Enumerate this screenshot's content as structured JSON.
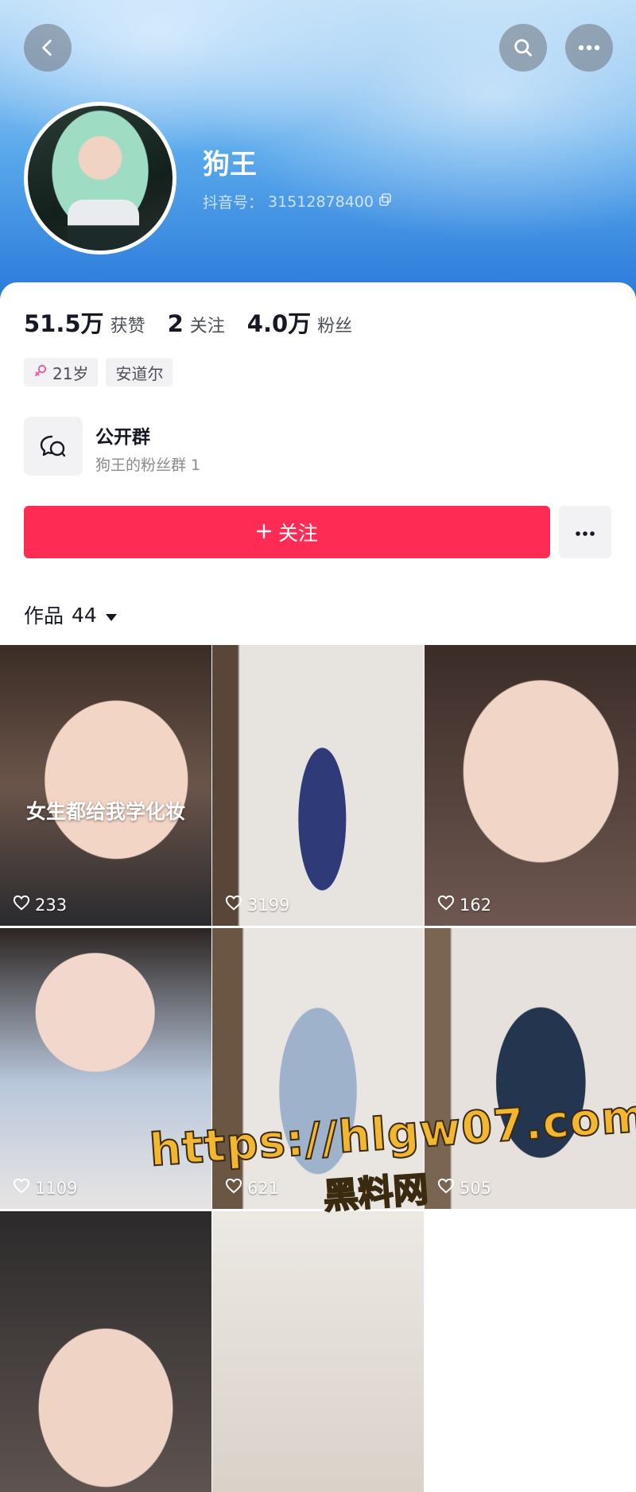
{
  "header": {
    "back_icon": "chevron-left-icon",
    "search_icon": "search-icon",
    "more_icon": "more-horizontal-icon",
    "accent_color": "#1f6fd6"
  },
  "profile": {
    "nickname": "狗王",
    "uid_label": "抖音号：",
    "uid_value": "31512878400"
  },
  "stats": [
    {
      "value": "51.5万",
      "label": "获赞"
    },
    {
      "value": "2",
      "label": "关注"
    },
    {
      "value": "4.0万",
      "label": "粉丝"
    }
  ],
  "tags": {
    "age": "21岁",
    "location": "安道尔"
  },
  "group": {
    "title": "公开群",
    "subtitle": "狗王的粉丝群 1"
  },
  "actions": {
    "follow_label": "关注",
    "follow_color": "#fe2c55"
  },
  "works": {
    "label": "作品",
    "count": "44"
  },
  "videos": [
    {
      "caption": "女生都给我学化妆",
      "likes": "233"
    },
    {
      "caption": "",
      "likes": "3199"
    },
    {
      "caption": "",
      "likes": "162"
    },
    {
      "caption": "",
      "likes": "1109"
    },
    {
      "caption": "",
      "likes": "621"
    },
    {
      "caption": "",
      "likes": "505"
    },
    {
      "caption": "",
      "likes": ""
    },
    {
      "caption": "",
      "likes": ""
    },
    {
      "caption": "",
      "likes": ""
    }
  ],
  "watermark": {
    "url": "https://hlgw07.com",
    "site": "黑料网"
  }
}
